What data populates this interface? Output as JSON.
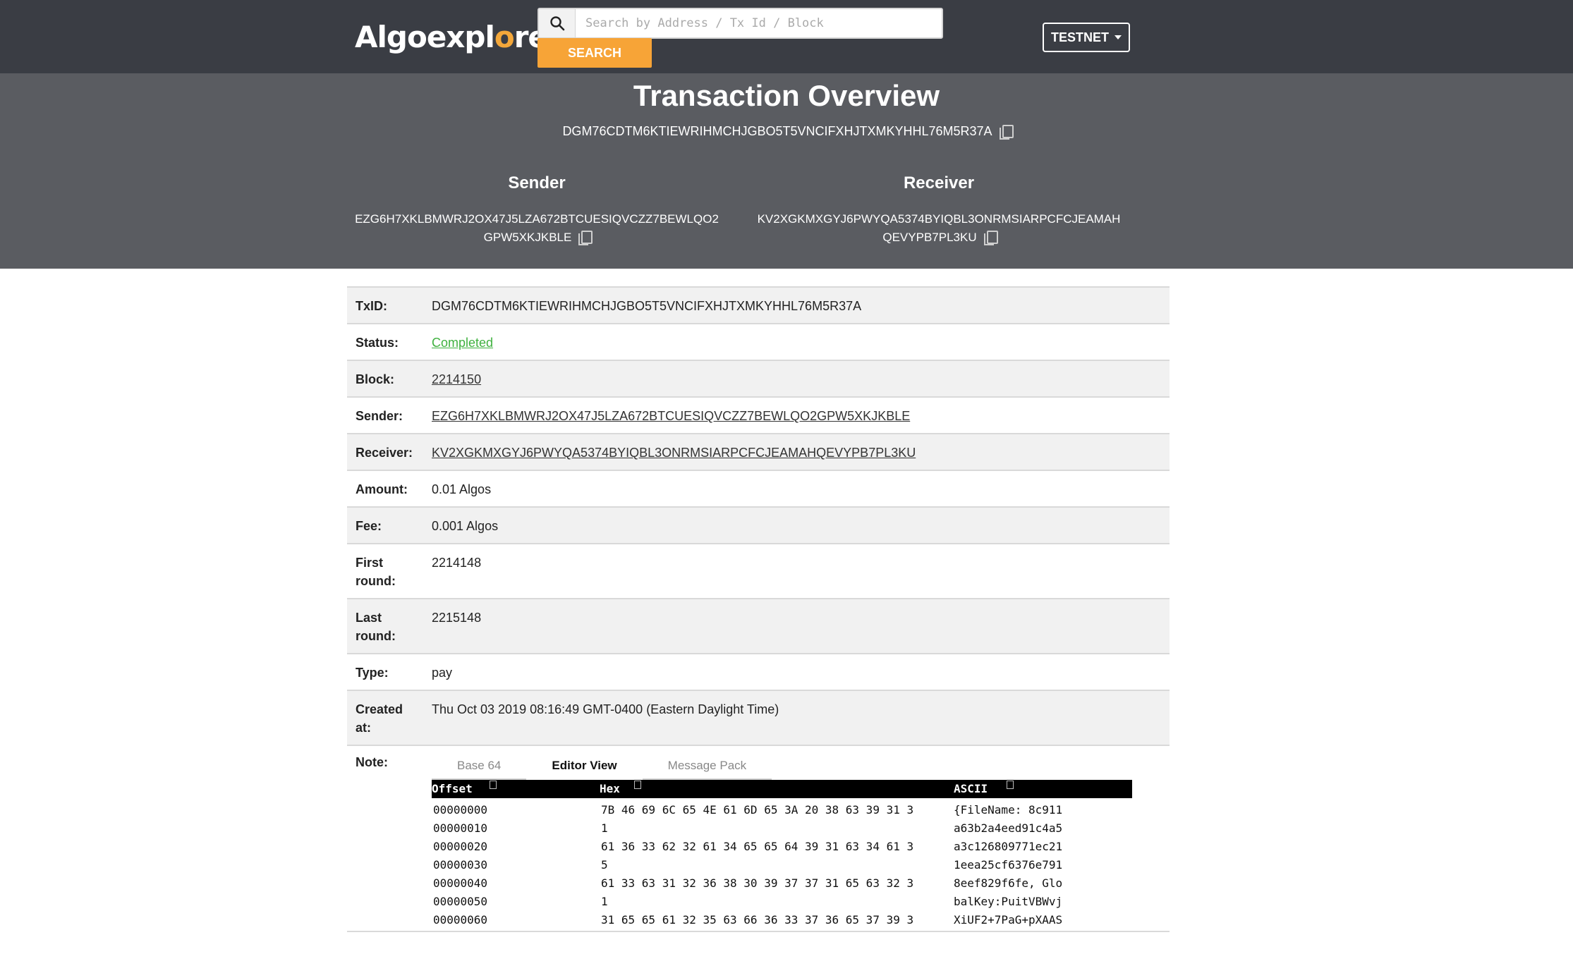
{
  "nav": {
    "logo_text_a": "Algoexpl",
    "logo_text_b": "o",
    "logo_text_c": "rer",
    "search_placeholder": "Search by Address / Tx Id / Block",
    "search_button": "SEARCH",
    "network": "TESTNET"
  },
  "hero": {
    "title": "Transaction Overview",
    "tx_id": "DGM76CDTM6KTIEWRIHMCHJGBO5T5VNCIFXHJTXMKYHHL76M5R37A",
    "sender_heading": "Sender",
    "sender_line1": "EZG6H7XKLBMWRJ2OX47J5LZA672BTCUESIQVCZZ7BEWLQO2",
    "sender_line2": "GPW5XKJKBLE",
    "receiver_heading": "Receiver",
    "receiver_line1": "KV2XGKMXGYJ6PWYQA5374BYIQBL3ONRMSIARPCFCJEAMAH",
    "receiver_line2": "QEVYPB7PL3KU"
  },
  "details": {
    "txid_label": "TxID:",
    "txid": "DGM76CDTM6KTIEWRIHMCHJGBO5T5VNCIFXHJTXMKYHHL76M5R37A",
    "status_label": "Status:",
    "status": "Completed",
    "block_label": "Block:",
    "block": "2214150",
    "sender_label": "Sender:",
    "sender": "EZG6H7XKLBMWRJ2OX47J5LZA672BTCUESIQVCZZ7BEWLQO2GPW5XKJKBLE",
    "receiver_label": "Receiver:",
    "receiver": "KV2XGKMXGYJ6PWYQA5374BYIQBL3ONRMSIARPCFCJEAMAHQEVYPB7PL3KU",
    "amount_label": "Amount:",
    "amount": "0.01 Algos",
    "fee_label": "Fee:",
    "fee": "0.001 Algos",
    "first_round_label_1": "First",
    "first_round_label_2": "round:",
    "first_round": "2214148",
    "last_round_label_1": "Last",
    "last_round_label_2": "round:",
    "last_round": "2215148",
    "type_label": "Type:",
    "type": "pay",
    "created_label_1": "Created",
    "created_label_2": "at:",
    "created": "Thu Oct 03 2019 08:16:49 GMT-0400 (Eastern Daylight Time)",
    "note_label": "Note:"
  },
  "note": {
    "tabs": [
      "Base 64",
      "Editor View",
      "Message Pack"
    ],
    "columns": {
      "offset": "Offset",
      "hex": "Hex",
      "ascii": "ASCII"
    },
    "lines": [
      {
        "offset": "00000000",
        "hex": "7B 46 69 6C 65 4E 61 6D 65 3A 20 38 63 39 31 3",
        "ascii": "{FileName: 8c911"
      },
      {
        "offset": "00000010",
        "hex": "1",
        "ascii": "a63b2a4eed91c4a5"
      },
      {
        "offset": "00000020",
        "hex": "61 36 33 62 32 61 34 65 65 64 39 31 63 34 61 3",
        "ascii": "a3c126809771ec21"
      },
      {
        "offset": "00000030",
        "hex": "5",
        "ascii": "1eea25cf6376e791"
      },
      {
        "offset": "00000040",
        "hex": "61 33 63 31 32 36 38 30 39 37 37 31 65 63 32 3",
        "ascii": "8eef829f6fe, Glo"
      },
      {
        "offset": "00000050",
        "hex": "1",
        "ascii": "balKey:PuitVBWvj"
      },
      {
        "offset": "00000060",
        "hex": "31 65 65 61 32 35 63 66 36 33 37 36 65 37 39 3",
        "ascii": "XiUF2+7PaG+pXAAS"
      }
    ]
  }
}
